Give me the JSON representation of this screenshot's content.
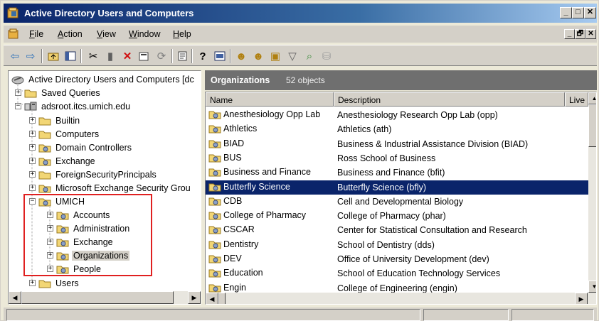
{
  "window": {
    "title": "Active Directory Users and Computers"
  },
  "caption_buttons": {
    "minimize": "_",
    "maximize": "□",
    "close": "✕"
  },
  "menu": {
    "items": [
      {
        "underline": "F",
        "rest": "ile"
      },
      {
        "underline": "A",
        "rest": "ction"
      },
      {
        "underline": "V",
        "rest": "iew"
      },
      {
        "underline": "W",
        "rest": "indow"
      },
      {
        "underline": "H",
        "rest": "elp"
      }
    ],
    "mdi_buttons": [
      "_",
      "🗗",
      "✕"
    ]
  },
  "toolbar": {
    "buttons": [
      "back-icon",
      "forward-icon",
      "up-folder-icon",
      "show-hide-tree-icon",
      "cut-icon",
      "copy-icon",
      "delete-icon",
      "properties-icon",
      "refresh-icon",
      "export-list-icon",
      "help-icon",
      "console-icon",
      "new-user-icon",
      "new-group-icon",
      "new-ou-icon",
      "filter-icon",
      "find-icon",
      "add-to-group-icon"
    ]
  },
  "tree": {
    "root": "Active Directory Users and Computers [dc",
    "saved_queries": "Saved Queries",
    "domain": "adsroot.itcs.umich.edu",
    "domain_children": [
      "Builtin",
      "Computers",
      "Domain Controllers",
      "Exchange",
      "ForeignSecurityPrincipals",
      "Microsoft Exchange Security Grou"
    ],
    "umich": "UMICH",
    "umich_children": [
      "Accounts",
      "Administration",
      "Exchange",
      "Organizations",
      "People"
    ],
    "users": "Users",
    "selected": "Organizations"
  },
  "right_pane": {
    "title": "Organizations",
    "count": "52 objects",
    "columns": [
      "Name",
      "Description",
      "Live C"
    ],
    "rows": [
      {
        "name": "Anesthesiology Opp Lab",
        "description": "Anesthesiology Research Opp Lab (opp)"
      },
      {
        "name": "Athletics",
        "description": "Athletics (ath)"
      },
      {
        "name": "BIAD",
        "description": "Business & Industrial Assistance Division (BIAD)"
      },
      {
        "name": "BUS",
        "description": "Ross School of Business"
      },
      {
        "name": "Business and Finance",
        "description": "Business and Finance (bfit)"
      },
      {
        "name": "Butterfly Science",
        "description": "Butterfly Science (bfly)"
      },
      {
        "name": "CDB",
        "description": "Cell and Developmental Biology"
      },
      {
        "name": "College of Pharmacy",
        "description": "College of Pharmacy (phar)"
      },
      {
        "name": "CSCAR",
        "description": "Center for Statistical Consultation and Research"
      },
      {
        "name": "Dentistry",
        "description": "School of Dentistry (dds)"
      },
      {
        "name": "DEV",
        "description": "Office of University Development (dev)"
      },
      {
        "name": "Education",
        "description": "School of Education Technology Services"
      },
      {
        "name": "Engin",
        "description": "College of Engineering (engin)"
      }
    ],
    "selected_row": "Butterfly Science"
  },
  "colors": {
    "selection": "#0a246a",
    "highlight_box": "#e02020",
    "header_bg": "#6f6f6f"
  }
}
